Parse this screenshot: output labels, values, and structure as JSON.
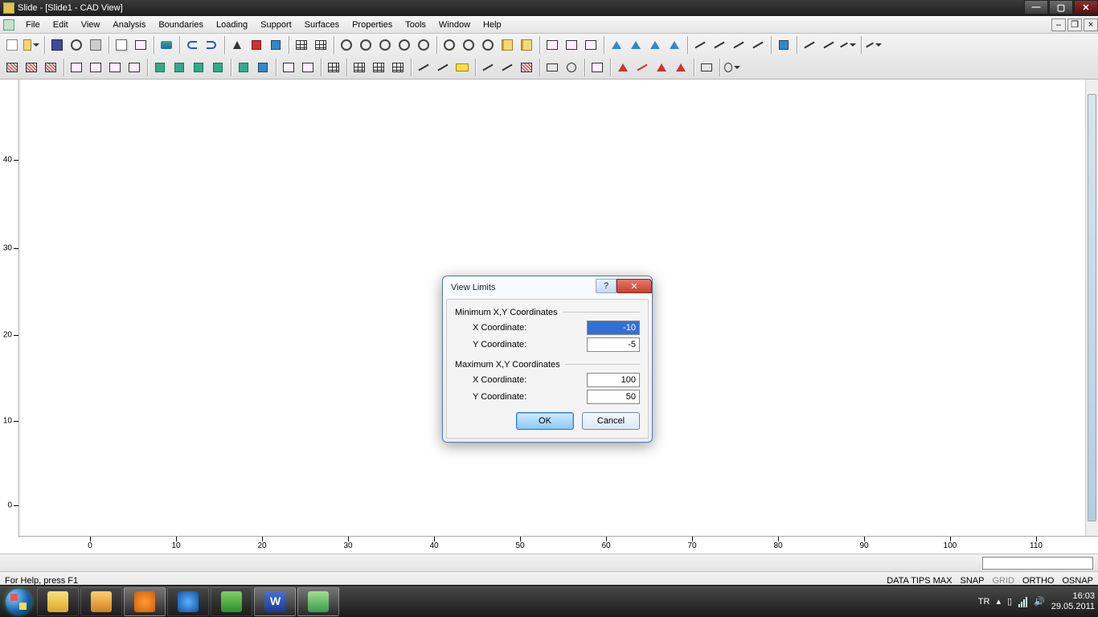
{
  "title": "Slide - [Slide1 - CAD View]",
  "menu": [
    "File",
    "Edit",
    "View",
    "Analysis",
    "Boundaries",
    "Loading",
    "Support",
    "Surfaces",
    "Properties",
    "Tools",
    "Window",
    "Help"
  ],
  "dialog": {
    "title": "View Limits",
    "group_min": "Minimum X,Y Coordinates",
    "group_max": "Maximum X,Y Coordinates",
    "x_label": "X Coordinate:",
    "y_label": "Y Coordinate:",
    "min_x": "-10",
    "min_y": "-5",
    "max_x": "100",
    "max_y": "50",
    "ok": "OK",
    "cancel": "Cancel"
  },
  "vruler_labels": [
    "40",
    "30",
    "20",
    "10",
    "0"
  ],
  "hruler_labels": [
    "0",
    "10",
    "20",
    "30",
    "40",
    "50",
    "60",
    "70",
    "80",
    "90",
    "100",
    "110"
  ],
  "status": {
    "help": "For Help, press F1",
    "datatips": "DATA TIPS MAX",
    "snap": "SNAP",
    "grid": "GRID",
    "ortho": "ORTHO",
    "osnap": "OSNAP"
  },
  "tray": {
    "lang": "TR",
    "time": "16:03",
    "date": "29.05.2011"
  }
}
